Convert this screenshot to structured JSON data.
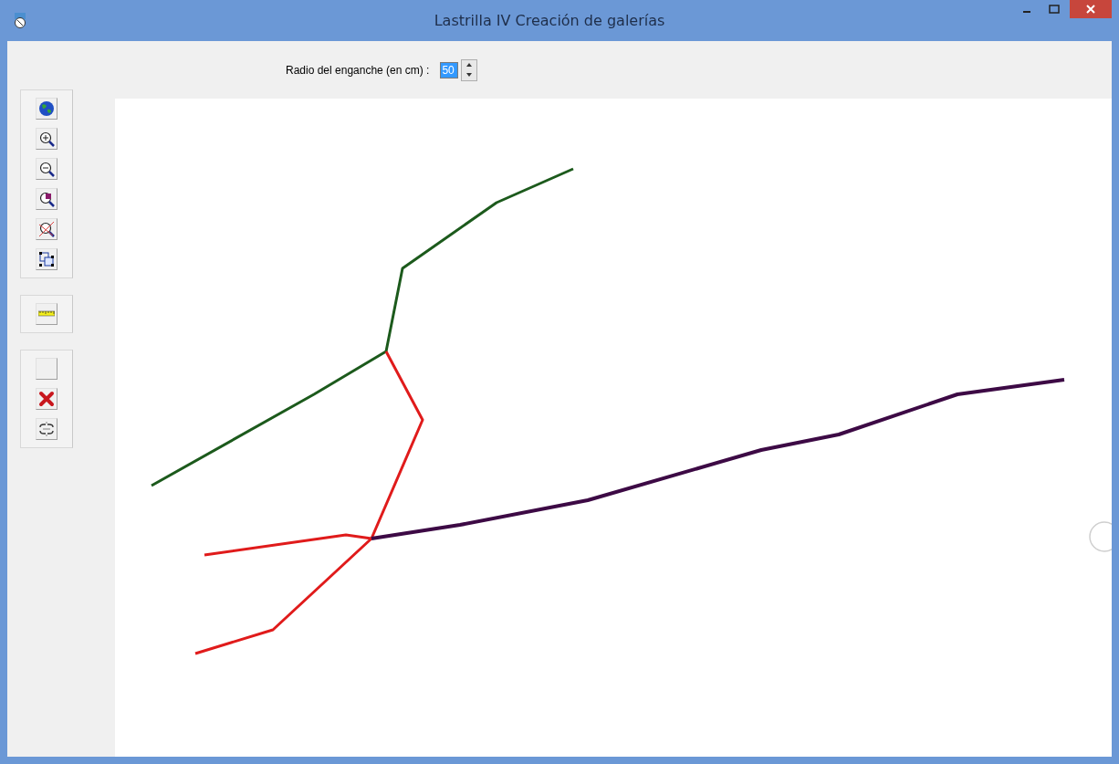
{
  "window": {
    "title": "Lastrilla IV Creación de galerías"
  },
  "radius": {
    "label": "Radio del enganche (en cm) :",
    "value": "50"
  },
  "toolbar": {
    "groups": [
      {
        "tools": [
          {
            "kind": "globe"
          },
          {
            "kind": "zoom-in"
          },
          {
            "kind": "zoom-out"
          },
          {
            "kind": "zoom-window"
          },
          {
            "kind": "zoom-cancel"
          },
          {
            "kind": "extent"
          }
        ]
      },
      {
        "tools": [
          {
            "kind": "ruler"
          }
        ]
      },
      {
        "tools": [
          {
            "kind": "blank"
          },
          {
            "kind": "delete"
          },
          {
            "kind": "unlink"
          }
        ]
      }
    ]
  }
}
